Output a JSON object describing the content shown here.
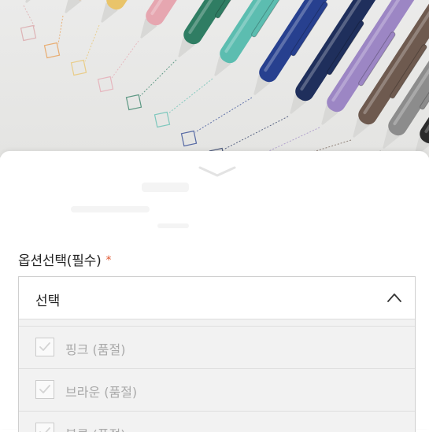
{
  "option_section": {
    "title": "옵션선택(필수)",
    "required_mark": "*",
    "select": {
      "selected_label": "선택",
      "expanded": true,
      "options": [
        {
          "label": "핑크 (품절)"
        },
        {
          "label": "브라운 (품절)"
        },
        {
          "label": "블루 (품절)"
        }
      ]
    }
  },
  "icons": {
    "handle": "chevron-down-icon",
    "toggle": "chevron-up-icon",
    "option_check": "check-icon"
  },
  "colors": {
    "required_mark": "#e0552f",
    "disabled_text": "#a9a9a9",
    "option_background": "#f2f2f2",
    "border": "#cfcfcf"
  },
  "pen_colors": [
    "#d9a0a4",
    "#e8984a",
    "#e9c46a",
    "#e6a6b0",
    "#2f7d63",
    "#5cbdb0",
    "#27408f",
    "#1f2f5c",
    "#9c86c4",
    "#6e5a4f",
    "#8c8c8c",
    "#2c2c2c"
  ]
}
